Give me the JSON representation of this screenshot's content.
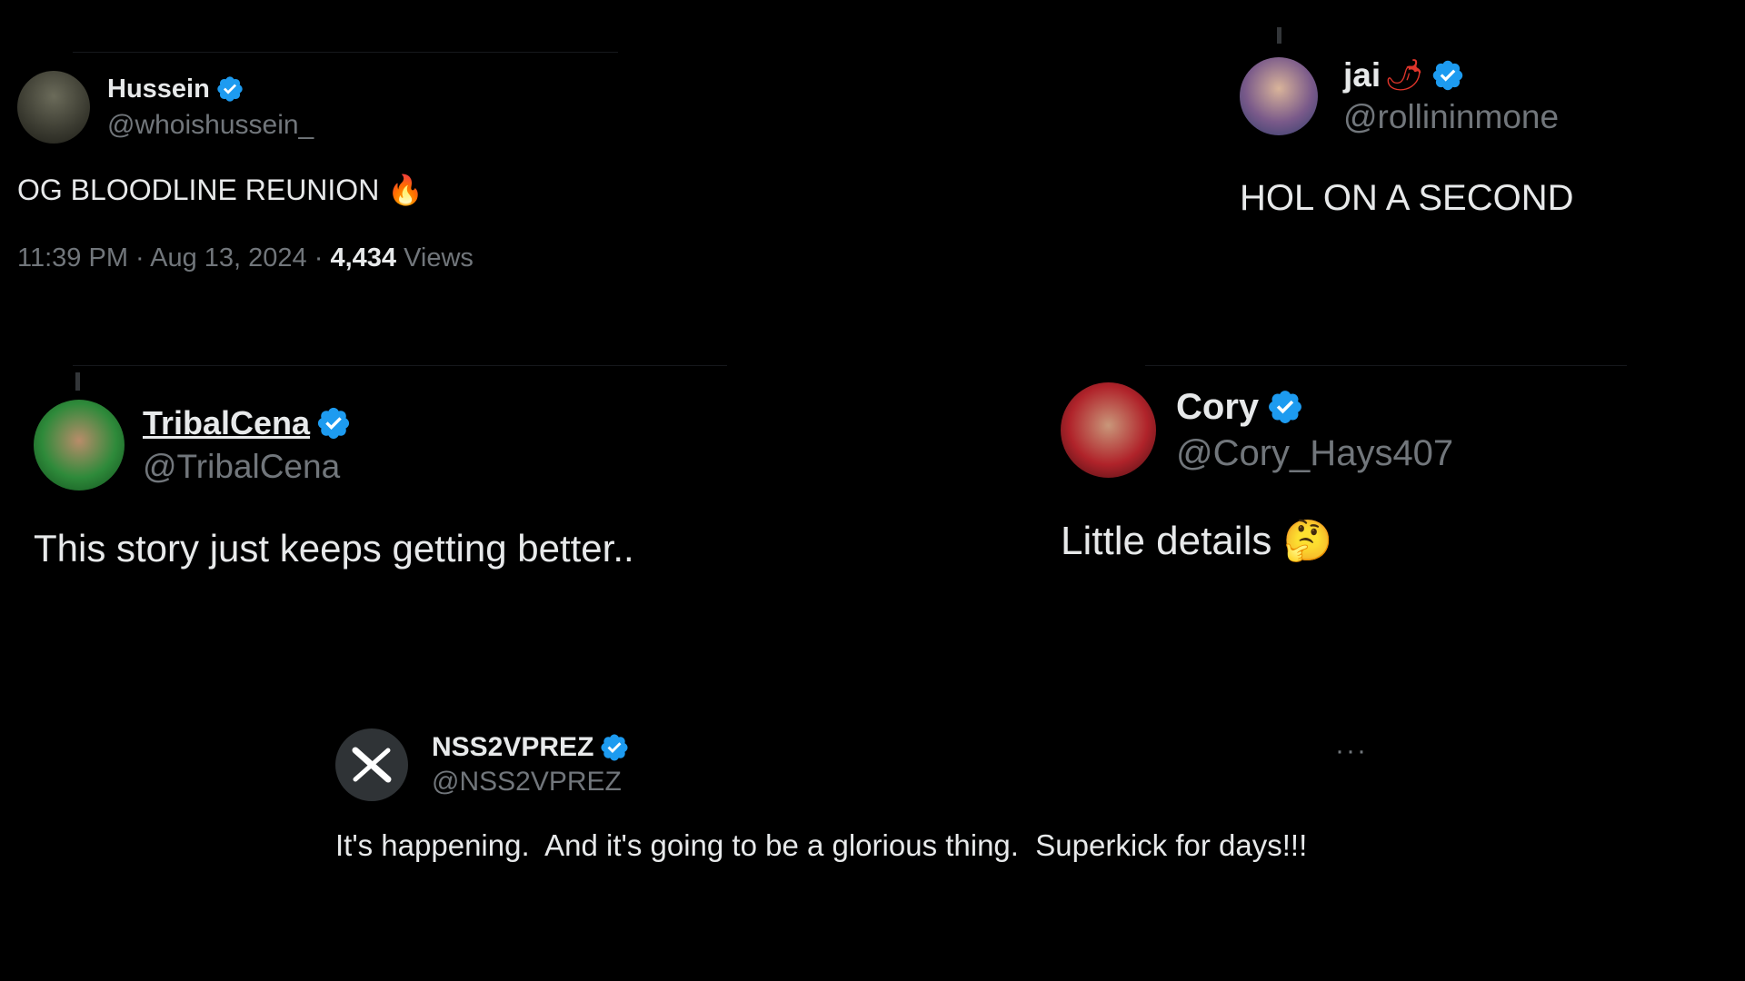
{
  "tweets": [
    {
      "name": "Hussein",
      "handle": "@whoishussein_",
      "text": "OG BLOODLINE REUNION",
      "emoji": "🔥",
      "time": "11:39 PM · Aug 13, 2024 · ",
      "views_count": "4,434",
      "views_label": " Views"
    },
    {
      "name": "jai",
      "name_emoji": "🌶",
      "handle": "@rollininmone",
      "text": "HOL ON A SECOND"
    },
    {
      "name": "TribalCena",
      "handle": "@TribalCena",
      "text": "This story just keeps getting better.."
    },
    {
      "name": "Cory",
      "handle": "@Cory_Hays407",
      "text": "Little details",
      "emoji": "🤔"
    },
    {
      "name": "NSS2VPREZ",
      "handle": "@NSS2VPREZ",
      "text": "It's happening.  And it's going to be a glorious thing.  Superkick for days!!!",
      "more": "···"
    }
  ],
  "colors": {
    "background": "#000000",
    "verified": "#1d9bf0",
    "text": "#e7e9ea",
    "muted": "#71767b"
  },
  "icons": {
    "verified": "verified-badge-icon",
    "avatar_x": "x-logo-icon",
    "more": "more-horizontal-icon"
  }
}
